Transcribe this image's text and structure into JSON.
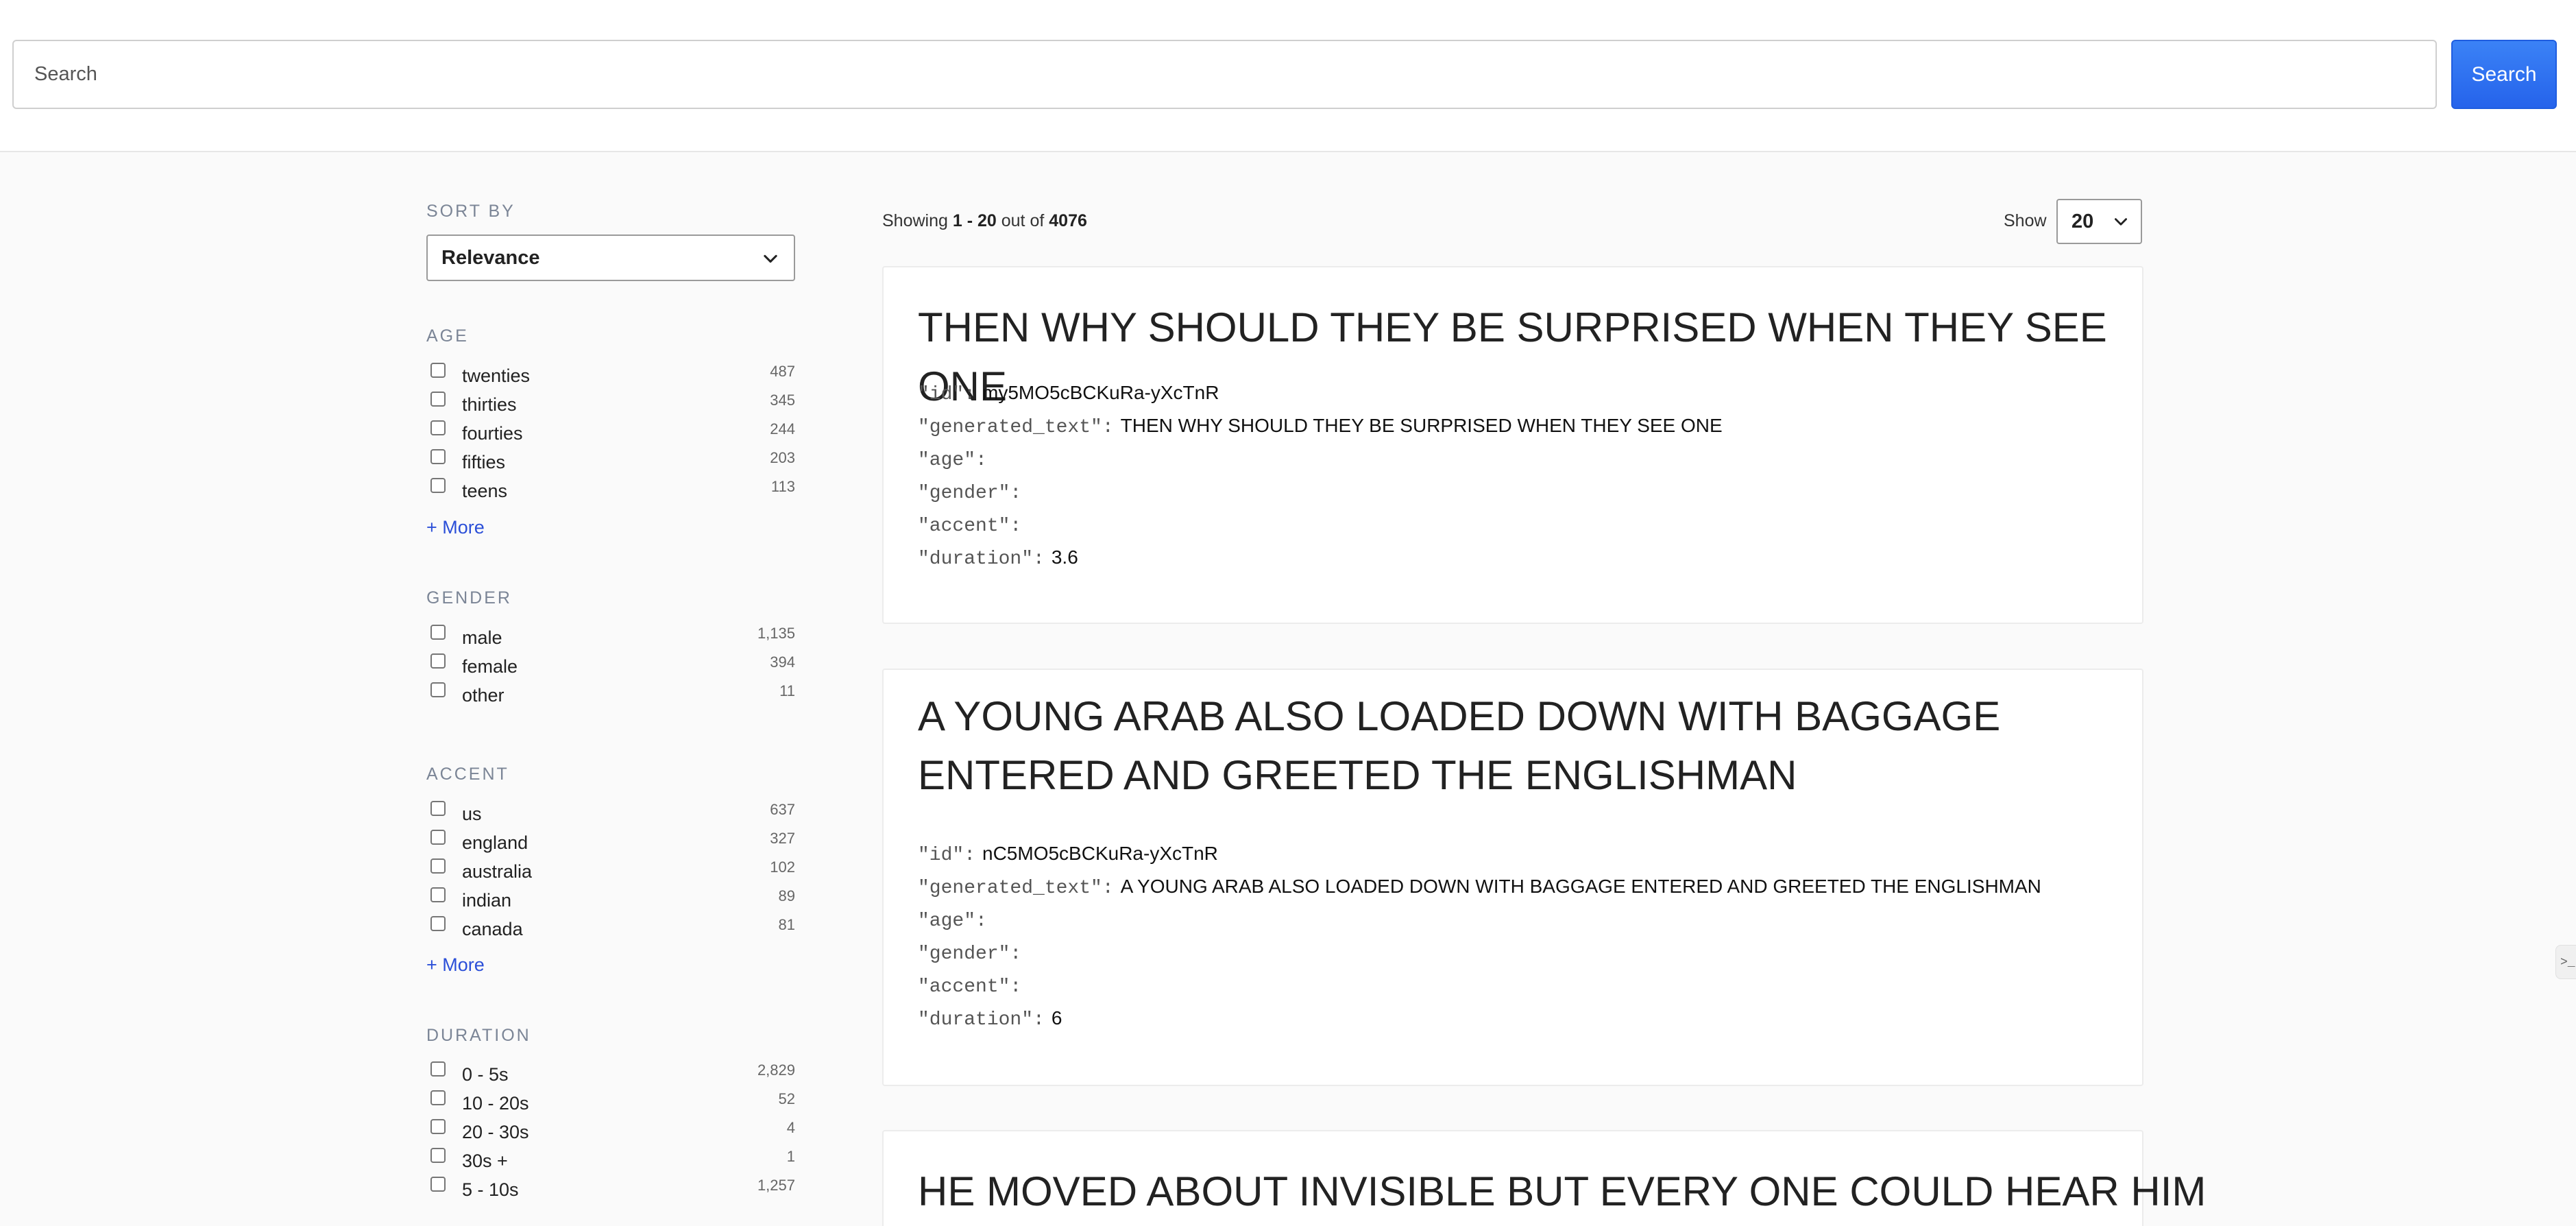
{
  "search": {
    "placeholder": "Search",
    "button_label": "Search"
  },
  "sort": {
    "title": "SORT BY",
    "selected": "Relevance"
  },
  "facets": {
    "age": {
      "title": "AGE",
      "items": [
        {
          "label": "twenties",
          "count": "487"
        },
        {
          "label": "thirties",
          "count": "345"
        },
        {
          "label": "fourties",
          "count": "244"
        },
        {
          "label": "fifties",
          "count": "203"
        },
        {
          "label": "teens",
          "count": "113"
        }
      ],
      "more_label": "+ More"
    },
    "gender": {
      "title": "GENDER",
      "items": [
        {
          "label": "male",
          "count": "1,135"
        },
        {
          "label": "female",
          "count": "394"
        },
        {
          "label": "other",
          "count": "11"
        }
      ]
    },
    "accent": {
      "title": "ACCENT",
      "items": [
        {
          "label": "us",
          "count": "637"
        },
        {
          "label": "england",
          "count": "327"
        },
        {
          "label": "australia",
          "count": "102"
        },
        {
          "label": "indian",
          "count": "89"
        },
        {
          "label": "canada",
          "count": "81"
        }
      ],
      "more_label": "+ More"
    },
    "duration": {
      "title": "DURATION",
      "items": [
        {
          "label": "0 - 5s",
          "count": "2,829"
        },
        {
          "label": "10 - 20s",
          "count": "52"
        },
        {
          "label": "20 - 30s",
          "count": "4"
        },
        {
          "label": "30s +",
          "count": "1"
        },
        {
          "label": "5 - 10s",
          "count": "1,257"
        }
      ]
    }
  },
  "results": {
    "showing_prefix": "Showing",
    "range": "1 - 20",
    "out_of": "out of",
    "total": "4076",
    "show_label": "Show",
    "page_size": "20",
    "keys": {
      "id": "\"id\":",
      "generated_text": "\"generated_text\":",
      "age": "\"age\":",
      "gender": "\"gender\":",
      "accent": "\"accent\":",
      "duration": "\"duration\":"
    },
    "items": [
      {
        "title": "THEN WHY SHOULD THEY BE SURPRISED WHEN THEY SEE ONE",
        "id": "my5MO5cBCKuRa-yXcTnR",
        "generated_text": "THEN WHY SHOULD THEY BE SURPRISED WHEN THEY SEE ONE",
        "age": "",
        "gender": "",
        "accent": "",
        "duration": "3.6"
      },
      {
        "title": "A YOUNG ARAB ALSO LOADED DOWN WITH BAGGAGE ENTERED AND GREETED THE ENGLISHMAN",
        "id": "nC5MO5cBCKuRa-yXcTnR",
        "generated_text": "A YOUNG ARAB ALSO LOADED DOWN WITH BAGGAGE ENTERED AND GREETED THE ENGLISHMAN",
        "age": "",
        "gender": "",
        "accent": "",
        "duration": "6"
      },
      {
        "title": "HE MOVED ABOUT INVISIBLE BUT EVERY ONE COULD HEAR HIM"
      }
    ]
  },
  "edge_tab": {
    "glyph": ">_"
  }
}
